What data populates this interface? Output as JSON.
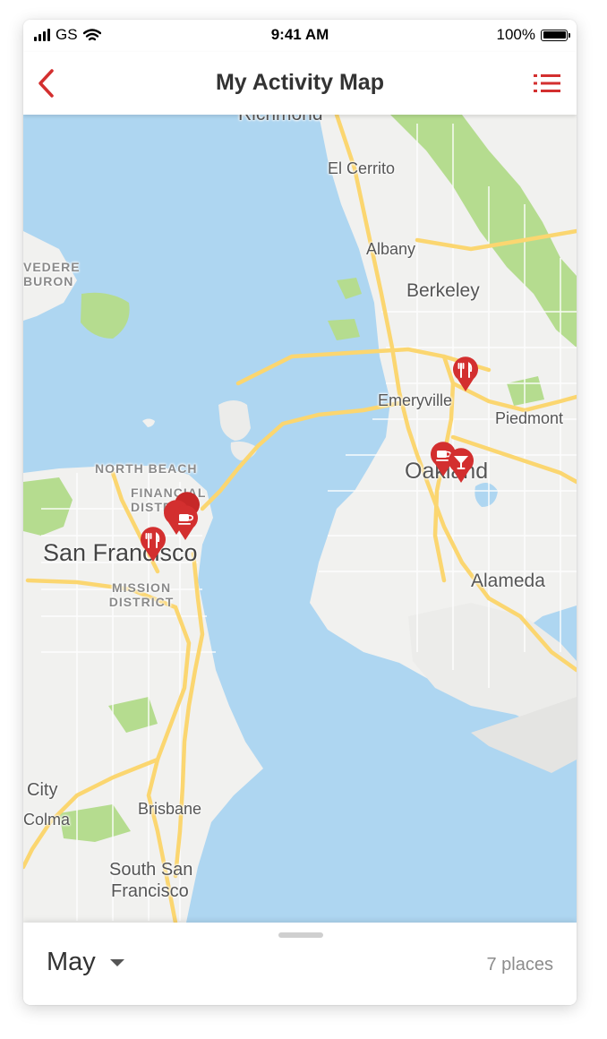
{
  "status_bar": {
    "carrier": "GS",
    "time": "9:41 AM",
    "battery": "100%",
    "battery_level": 1.0
  },
  "header": {
    "title": "My Activity Map",
    "back_icon": "chevron-left-icon",
    "list_icon": "list-icon",
    "accent_color": "#d32f2f"
  },
  "map": {
    "labels": {
      "richmond": "Richmond",
      "el_cerrito": "El Cerrito",
      "albany": "Albany",
      "berkeley": "Berkeley",
      "emeryville": "Emeryville",
      "piedmont": "Piedmont",
      "oakland": "Oakland",
      "alameda": "Alameda",
      "north_beach": "NORTH BEACH",
      "financial_district": "FINANCIAL DISTRICT",
      "san_francisco": "San Francisco",
      "mission_district": "MISSION DISTRICT",
      "belvedere": "VEDERE",
      "tiburon": "BURON",
      "daly_city": "City",
      "colma": "Colma",
      "brisbane": "Brisbane",
      "south_san_francisco_1": "South San",
      "south_san_francisco_2": "Francisco"
    },
    "pins": [
      {
        "category": "restaurant",
        "icon": "fork-knife-icon",
        "area": "Emeryville"
      },
      {
        "category": "cafe",
        "icon": "coffee-cup-icon",
        "area": "Oakland"
      },
      {
        "category": "bar",
        "icon": "cocktail-icon",
        "area": "Oakland"
      },
      {
        "category": "cafe",
        "icon": "coffee-cup-icon",
        "area": "Financial District"
      },
      {
        "category": "cafe",
        "icon": "coffee-cup-icon",
        "area": "Financial District"
      },
      {
        "category": "cafe",
        "icon": "coffee-cup-icon",
        "area": "Financial District"
      },
      {
        "category": "restaurant",
        "icon": "fork-knife-icon",
        "area": "San Francisco"
      }
    ],
    "colors": {
      "water": "#aed6f1",
      "land": "#f1f1ef",
      "park": "#b5dc8f",
      "highway": "#fbd670",
      "pin": "#d32f2f"
    }
  },
  "bottom_sheet": {
    "month": "May",
    "count": "7 places"
  }
}
